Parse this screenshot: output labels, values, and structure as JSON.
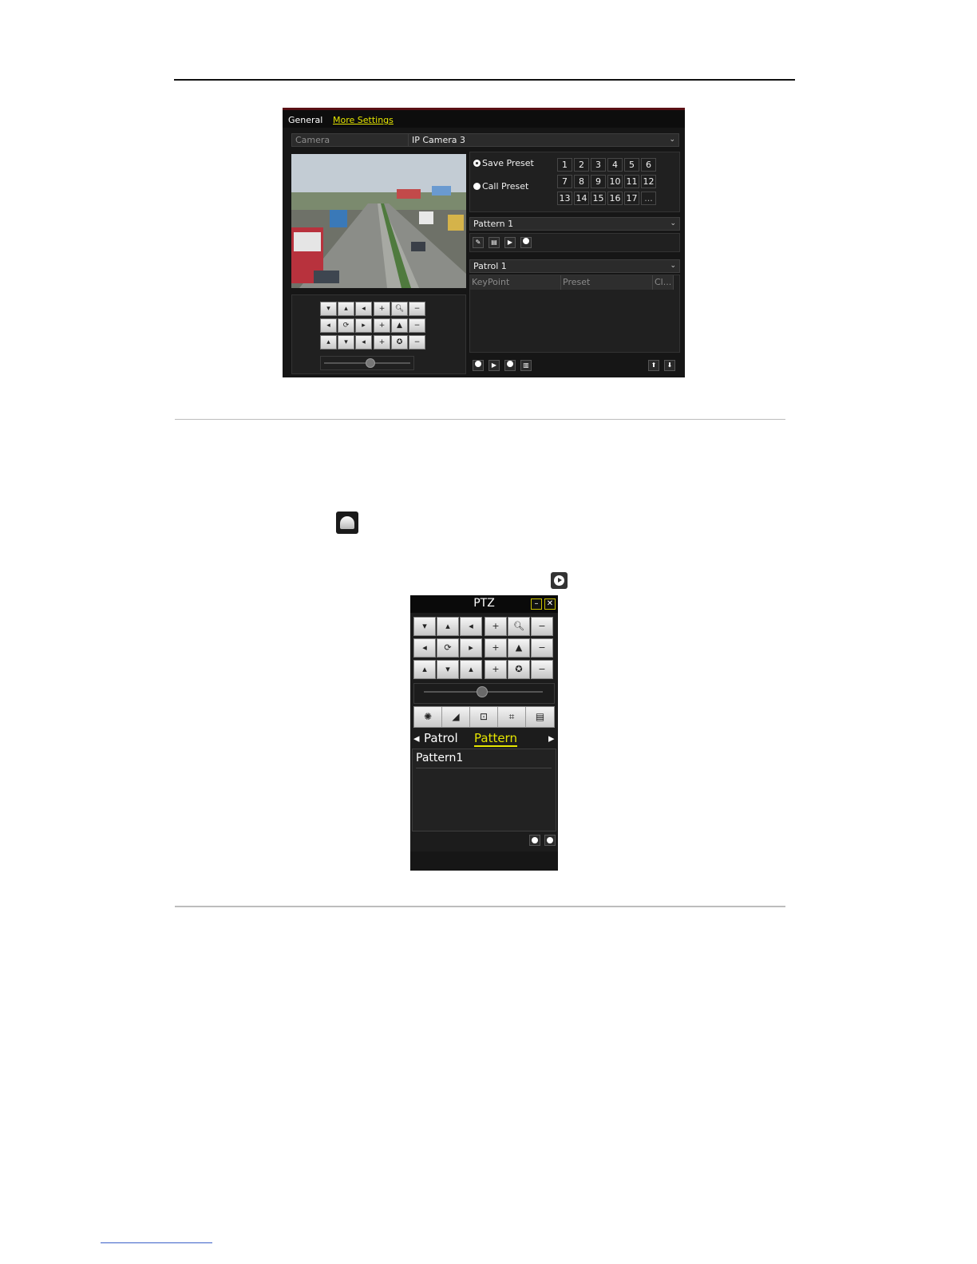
{
  "figure1": {
    "tabs": [
      "General",
      "More Settings"
    ],
    "camera_label": "Camera",
    "camera_value": "IP Camera 3",
    "save_preset": "Save Preset",
    "call_preset": "Call Preset",
    "preset_numbers": [
      "1",
      "2",
      "3",
      "4",
      "5",
      "6",
      "7",
      "8",
      "9",
      "10",
      "11",
      "12",
      "13",
      "14",
      "15",
      "16",
      "17",
      "..."
    ],
    "pattern_value": "Pattern 1",
    "patrol_value": "Patrol 1",
    "table_headers": [
      "KeyPoint",
      "Preset",
      "Cl..."
    ]
  },
  "figure2": {
    "title": "PTZ",
    "tabs": [
      "Patrol",
      "Pattern"
    ],
    "pattern_items": [
      "Pattern1"
    ]
  },
  "colors": {
    "accent": "#e6e600",
    "panel": "#1c1c1c",
    "titlebar": "#5a0f14"
  }
}
